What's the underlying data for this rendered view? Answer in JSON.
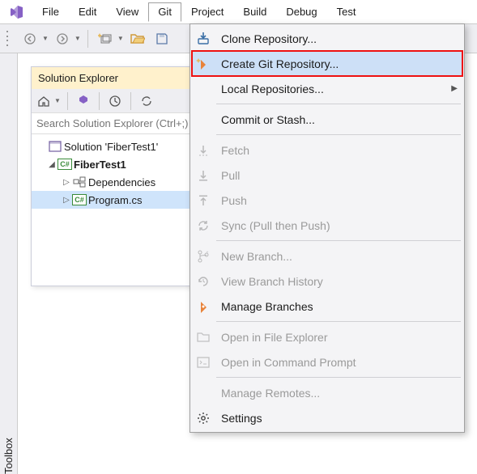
{
  "menubar": {
    "items": [
      "File",
      "Edit",
      "View",
      "Git",
      "Project",
      "Build",
      "Debug",
      "Test"
    ],
    "open_index": 3
  },
  "solution_explorer": {
    "title": "Solution Explorer",
    "search_placeholder": "Search Solution Explorer (Ctrl+;)",
    "solution_label": "Solution 'FiberTest1'",
    "project_label": "FiberTest1",
    "dependencies_label": "Dependencies",
    "program_label": "Program.cs"
  },
  "toolbox": {
    "label": "Toolbox"
  },
  "git_menu": {
    "clone": "Clone Repository...",
    "create": "Create Git Repository...",
    "local": "Local Repositories...",
    "commit": "Commit or Stash...",
    "fetch": "Fetch",
    "pull": "Pull",
    "push": "Push",
    "sync": "Sync (Pull then Push)",
    "new_branch": "New Branch...",
    "history": "View Branch History",
    "manage_branches": "Manage Branches",
    "open_explorer": "Open in File Explorer",
    "open_cmd": "Open in Command Prompt",
    "remotes": "Manage Remotes...",
    "settings": "Settings"
  }
}
